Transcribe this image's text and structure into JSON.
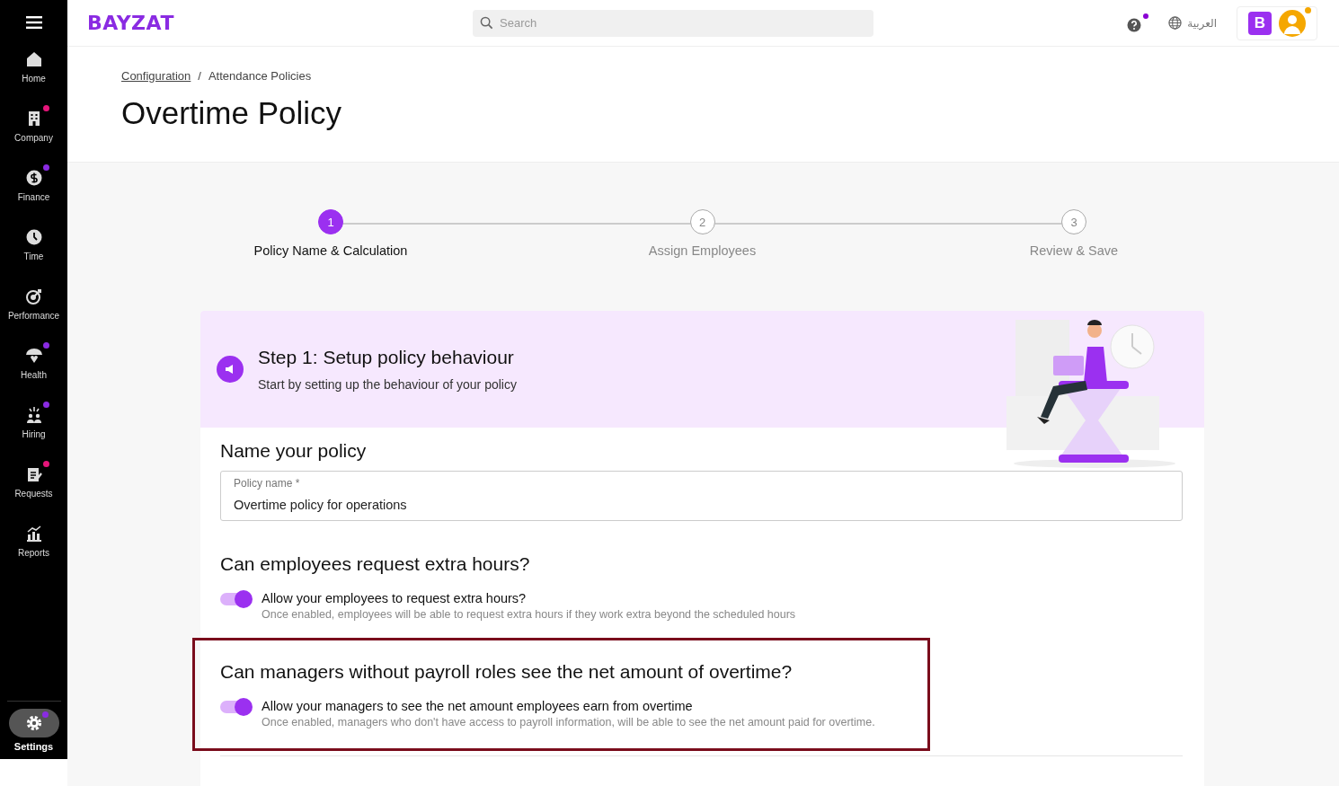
{
  "logo": "BAYZAT",
  "search": {
    "placeholder": "Search"
  },
  "topbar": {
    "help_badge": true,
    "language": "العربية",
    "company_initial": "B",
    "avatar_badge": true
  },
  "sidebar": {
    "items": [
      {
        "label": "Home",
        "selected": false
      },
      {
        "label": "Company",
        "selected": false,
        "color": "#e6157a"
      },
      {
        "label": "Finance",
        "selected": false,
        "color": "#8a2be2"
      },
      {
        "label": "Time",
        "selected": false
      },
      {
        "label": "Performance",
        "selected": false
      },
      {
        "label": "Health",
        "selected": false,
        "color": "#8a2be2"
      },
      {
        "label": "Hiring",
        "selected": false,
        "color": "#8a2be2"
      },
      {
        "label": "Requests",
        "selected": false,
        "color": "#e6157a"
      },
      {
        "label": "Reports",
        "selected": false
      }
    ],
    "settings": {
      "label": "Settings",
      "selected": true,
      "color": "#8a2be2"
    }
  },
  "breadcrumb": [
    {
      "label": "Configuration",
      "link": true
    },
    {
      "label": "/",
      "link": false
    },
    {
      "label": "Attendance Policies",
      "link": false
    }
  ],
  "page_title": "Overtime Policy",
  "steps": [
    {
      "number": "1",
      "label": "Policy Name & Calculation",
      "selected": true
    },
    {
      "number": "2",
      "label": "Assign Employees",
      "selected": false
    },
    {
      "number": "3",
      "label": "Review & Save",
      "selected": false
    }
  ],
  "banner": {
    "title": "Step 1: Setup policy behaviour",
    "subtitle": "Start by setting up the behaviour of your policy"
  },
  "name_section": {
    "heading": "Name your policy",
    "field_label": "Policy name *",
    "value": "Overtime policy for operations"
  },
  "questions": [
    {
      "heading": "Can employees request extra hours?",
      "toggle_label": "Allow your employees to request extra hours?",
      "description": "Once enabled, employees will be able to request extra hours if they work extra beyond the scheduled hours",
      "on": true,
      "highlighted": false
    },
    {
      "heading": "Can managers without payroll roles see the net amount of overtime?",
      "toggle_label": "Allow your managers to see the net amount employees earn from overtime",
      "description": "Once enabled, managers who don't have access to payroll information, will be able to see the net amount paid for overtime.",
      "on": true,
      "highlighted": true
    }
  ]
}
